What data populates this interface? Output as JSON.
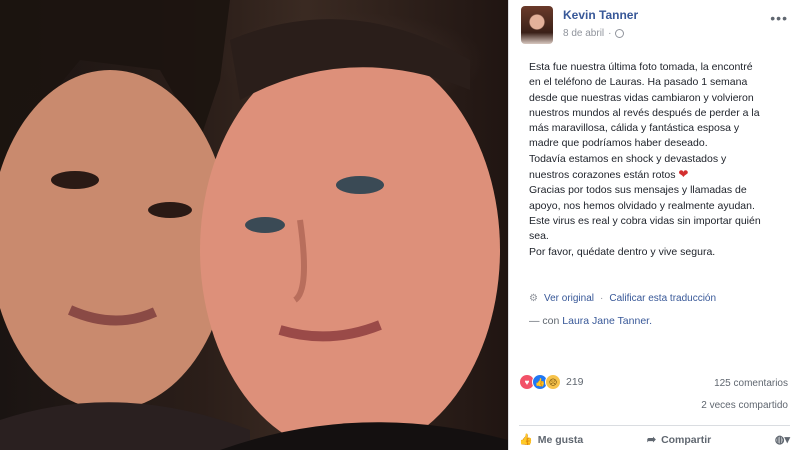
{
  "post": {
    "author": "Kevin Tanner",
    "date": "8 de abril",
    "more_label": "•••",
    "body": "Esta fue nuestra última foto tomada, la encontré\nen el teléfono de Lauras. Ha pasado 1 semana\ndesde que nuestras vidas cambiaron y volvieron\nnuestros mundos al revés después de perder a la\nmás maravillosa, cálida y fantástica esposa y\nmadre que podríamos haber deseado.\nTodavía estamos en shock y devastados y\nnuestros corazones están rotos",
    "body_continued": "Gracias por todos sus mensajes y llamadas de\napoyo, nos hemos olvidado y realmente ayudan.\nEste virus es real y cobra vidas sin importar quién\nsea.\nPor favor, quédate dentro y vive segura.",
    "view_original": "Ver original",
    "separator": "·",
    "rate_translation": "Calificar esta traducción",
    "with_prefix": "— con",
    "tagged_name": "Laura Jane Tanner."
  },
  "stats": {
    "reaction_count": "219",
    "comments": "125 comentarios",
    "shares": "2 veces compartido"
  },
  "actions": {
    "like": "Me gusta",
    "share": "Compartir"
  },
  "icons": {
    "globe": "globe-icon",
    "heart": "heart-icon",
    "like": "thumbs-up-icon",
    "share": "share-arrow-icon"
  }
}
